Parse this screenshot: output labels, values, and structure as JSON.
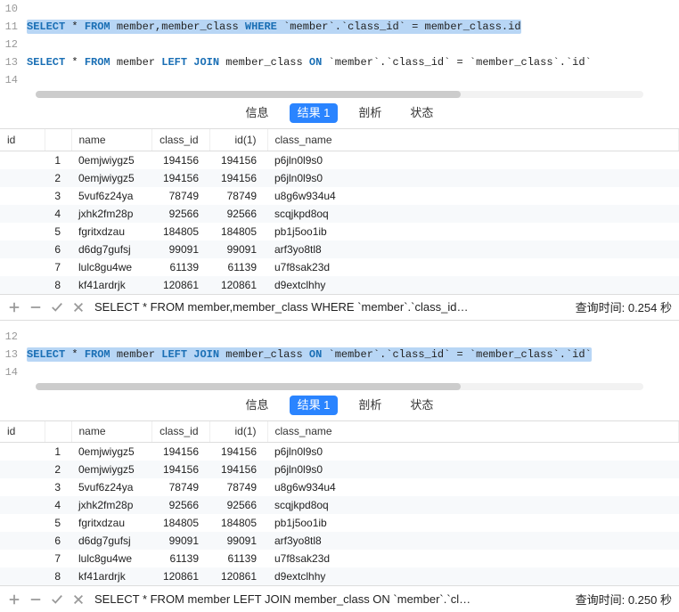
{
  "colors": {
    "accent": "#2a84ff",
    "highlight": "#b8d6f5"
  },
  "top": {
    "editor": {
      "lines": [
        {
          "num": "10",
          "text": ""
        },
        {
          "num": "11",
          "highlighted": true,
          "tokens": [
            "SELECT",
            " * ",
            "FROM",
            " member,member_class ",
            "WHERE",
            " `member`.`class_id` = member_class.id"
          ]
        },
        {
          "num": "12",
          "text": ""
        },
        {
          "num": "13",
          "highlighted": false,
          "tokens": [
            "SELECT",
            " * ",
            "FROM",
            " member ",
            "LEFT JOIN",
            " member_class ",
            "ON",
            " `member`.`class_id` = `member_class`.`id`"
          ]
        },
        {
          "num": "14",
          "text": ""
        }
      ]
    },
    "tabs": {
      "info": "信息",
      "result": "结果 1",
      "profile": "剖析",
      "status": "状态"
    },
    "columns": {
      "id": "id",
      "name": "name",
      "class_id": "class_id",
      "id1": "id(1)",
      "class_name": "class_name"
    },
    "rows": [
      {
        "n": "1",
        "name": "0emjwiygz5",
        "class_id": "194156",
        "id1": "194156",
        "class_name": "p6jln0l9s0"
      },
      {
        "n": "2",
        "name": "0emjwiygz5",
        "class_id": "194156",
        "id1": "194156",
        "class_name": "p6jln0l9s0"
      },
      {
        "n": "3",
        "name": "5vuf6z24ya",
        "class_id": "78749",
        "id1": "78749",
        "class_name": "u8g6w934u4"
      },
      {
        "n": "4",
        "name": "jxhk2fm28p",
        "class_id": "92566",
        "id1": "92566",
        "class_name": "scqjkpd8oq"
      },
      {
        "n": "5",
        "name": "fgritxdzau",
        "class_id": "184805",
        "id1": "184805",
        "class_name": "pb1j5oo1ib"
      },
      {
        "n": "6",
        "name": "d6dg7gufsj",
        "class_id": "99091",
        "id1": "99091",
        "class_name": "arf3yo8tl8"
      },
      {
        "n": "7",
        "name": "lulc8gu4we",
        "class_id": "61139",
        "id1": "61139",
        "class_name": "u7f8sak23d"
      },
      {
        "n": "8",
        "name": "kf41ardrjk",
        "class_id": "120861",
        "id1": "120861",
        "class_name": "d9extclhhy"
      }
    ],
    "status_sql": "SELECT * FROM member,member_class WHERE `member`.`class_id…",
    "query_time_label": "查询时间:",
    "query_time_value": "0.254 秒"
  },
  "bottom": {
    "editor": {
      "lines": [
        {
          "num": "12",
          "text": ""
        },
        {
          "num": "13",
          "highlighted": true,
          "tokens": [
            "SELECT",
            " * ",
            "FROM",
            " member ",
            "LEFT JOIN",
            " member_class ",
            "ON",
            " `member`.`class_id` = `member_class`.`id`"
          ]
        },
        {
          "num": "14",
          "text": ""
        }
      ]
    },
    "tabs": {
      "info": "信息",
      "result": "结果 1",
      "profile": "剖析",
      "status": "状态"
    },
    "columns": {
      "id": "id",
      "name": "name",
      "class_id": "class_id",
      "id1": "id(1)",
      "class_name": "class_name"
    },
    "rows": [
      {
        "n": "1",
        "name": "0emjwiygz5",
        "class_id": "194156",
        "id1": "194156",
        "class_name": "p6jln0l9s0"
      },
      {
        "n": "2",
        "name": "0emjwiygz5",
        "class_id": "194156",
        "id1": "194156",
        "class_name": "p6jln0l9s0"
      },
      {
        "n": "3",
        "name": "5vuf6z24ya",
        "class_id": "78749",
        "id1": "78749",
        "class_name": "u8g6w934u4"
      },
      {
        "n": "4",
        "name": "jxhk2fm28p",
        "class_id": "92566",
        "id1": "92566",
        "class_name": "scqjkpd8oq"
      },
      {
        "n": "5",
        "name": "fgritxdzau",
        "class_id": "184805",
        "id1": "184805",
        "class_name": "pb1j5oo1ib"
      },
      {
        "n": "6",
        "name": "d6dg7gufsj",
        "class_id": "99091",
        "id1": "99091",
        "class_name": "arf3yo8tl8"
      },
      {
        "n": "7",
        "name": "lulc8gu4we",
        "class_id": "61139",
        "id1": "61139",
        "class_name": "u7f8sak23d"
      },
      {
        "n": "8",
        "name": "kf41ardrjk",
        "class_id": "120861",
        "id1": "120861",
        "class_name": "d9extclhhy"
      }
    ],
    "status_sql": "SELECT * FROM member LEFT JOIN member_class ON `member`.`cl…",
    "query_time_label": "查询时间:",
    "query_time_value": "0.250 秒"
  }
}
